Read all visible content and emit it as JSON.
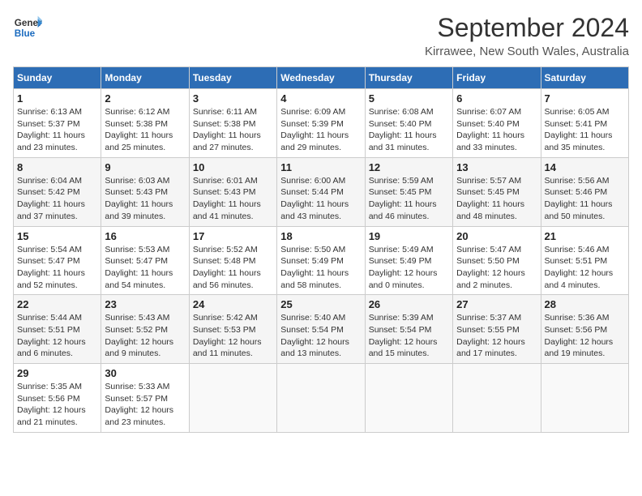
{
  "header": {
    "logo_line1": "General",
    "logo_line2": "Blue",
    "month": "September 2024",
    "location": "Kirrawee, New South Wales, Australia"
  },
  "weekdays": [
    "Sunday",
    "Monday",
    "Tuesday",
    "Wednesday",
    "Thursday",
    "Friday",
    "Saturday"
  ],
  "weeks": [
    [
      {
        "day": "1",
        "sunrise": "6:13 AM",
        "sunset": "5:37 PM",
        "daylight": "11 hours and 23 minutes."
      },
      {
        "day": "2",
        "sunrise": "6:12 AM",
        "sunset": "5:38 PM",
        "daylight": "11 hours and 25 minutes."
      },
      {
        "day": "3",
        "sunrise": "6:11 AM",
        "sunset": "5:38 PM",
        "daylight": "11 hours and 27 minutes."
      },
      {
        "day": "4",
        "sunrise": "6:09 AM",
        "sunset": "5:39 PM",
        "daylight": "11 hours and 29 minutes."
      },
      {
        "day": "5",
        "sunrise": "6:08 AM",
        "sunset": "5:40 PM",
        "daylight": "11 hours and 31 minutes."
      },
      {
        "day": "6",
        "sunrise": "6:07 AM",
        "sunset": "5:40 PM",
        "daylight": "11 hours and 33 minutes."
      },
      {
        "day": "7",
        "sunrise": "6:05 AM",
        "sunset": "5:41 PM",
        "daylight": "11 hours and 35 minutes."
      }
    ],
    [
      {
        "day": "8",
        "sunrise": "6:04 AM",
        "sunset": "5:42 PM",
        "daylight": "11 hours and 37 minutes."
      },
      {
        "day": "9",
        "sunrise": "6:03 AM",
        "sunset": "5:43 PM",
        "daylight": "11 hours and 39 minutes."
      },
      {
        "day": "10",
        "sunrise": "6:01 AM",
        "sunset": "5:43 PM",
        "daylight": "11 hours and 41 minutes."
      },
      {
        "day": "11",
        "sunrise": "6:00 AM",
        "sunset": "5:44 PM",
        "daylight": "11 hours and 43 minutes."
      },
      {
        "day": "12",
        "sunrise": "5:59 AM",
        "sunset": "5:45 PM",
        "daylight": "11 hours and 46 minutes."
      },
      {
        "day": "13",
        "sunrise": "5:57 AM",
        "sunset": "5:45 PM",
        "daylight": "11 hours and 48 minutes."
      },
      {
        "day": "14",
        "sunrise": "5:56 AM",
        "sunset": "5:46 PM",
        "daylight": "11 hours and 50 minutes."
      }
    ],
    [
      {
        "day": "15",
        "sunrise": "5:54 AM",
        "sunset": "5:47 PM",
        "daylight": "11 hours and 52 minutes."
      },
      {
        "day": "16",
        "sunrise": "5:53 AM",
        "sunset": "5:47 PM",
        "daylight": "11 hours and 54 minutes."
      },
      {
        "day": "17",
        "sunrise": "5:52 AM",
        "sunset": "5:48 PM",
        "daylight": "11 hours and 56 minutes."
      },
      {
        "day": "18",
        "sunrise": "5:50 AM",
        "sunset": "5:49 PM",
        "daylight": "11 hours and 58 minutes."
      },
      {
        "day": "19",
        "sunrise": "5:49 AM",
        "sunset": "5:49 PM",
        "daylight": "12 hours and 0 minutes."
      },
      {
        "day": "20",
        "sunrise": "5:47 AM",
        "sunset": "5:50 PM",
        "daylight": "12 hours and 2 minutes."
      },
      {
        "day": "21",
        "sunrise": "5:46 AM",
        "sunset": "5:51 PM",
        "daylight": "12 hours and 4 minutes."
      }
    ],
    [
      {
        "day": "22",
        "sunrise": "5:44 AM",
        "sunset": "5:51 PM",
        "daylight": "12 hours and 6 minutes."
      },
      {
        "day": "23",
        "sunrise": "5:43 AM",
        "sunset": "5:52 PM",
        "daylight": "12 hours and 9 minutes."
      },
      {
        "day": "24",
        "sunrise": "5:42 AM",
        "sunset": "5:53 PM",
        "daylight": "12 hours and 11 minutes."
      },
      {
        "day": "25",
        "sunrise": "5:40 AM",
        "sunset": "5:54 PM",
        "daylight": "12 hours and 13 minutes."
      },
      {
        "day": "26",
        "sunrise": "5:39 AM",
        "sunset": "5:54 PM",
        "daylight": "12 hours and 15 minutes."
      },
      {
        "day": "27",
        "sunrise": "5:37 AM",
        "sunset": "5:55 PM",
        "daylight": "12 hours and 17 minutes."
      },
      {
        "day": "28",
        "sunrise": "5:36 AM",
        "sunset": "5:56 PM",
        "daylight": "12 hours and 19 minutes."
      }
    ],
    [
      {
        "day": "29",
        "sunrise": "5:35 AM",
        "sunset": "5:56 PM",
        "daylight": "12 hours and 21 minutes."
      },
      {
        "day": "30",
        "sunrise": "5:33 AM",
        "sunset": "5:57 PM",
        "daylight": "12 hours and 23 minutes."
      },
      null,
      null,
      null,
      null,
      null
    ]
  ]
}
